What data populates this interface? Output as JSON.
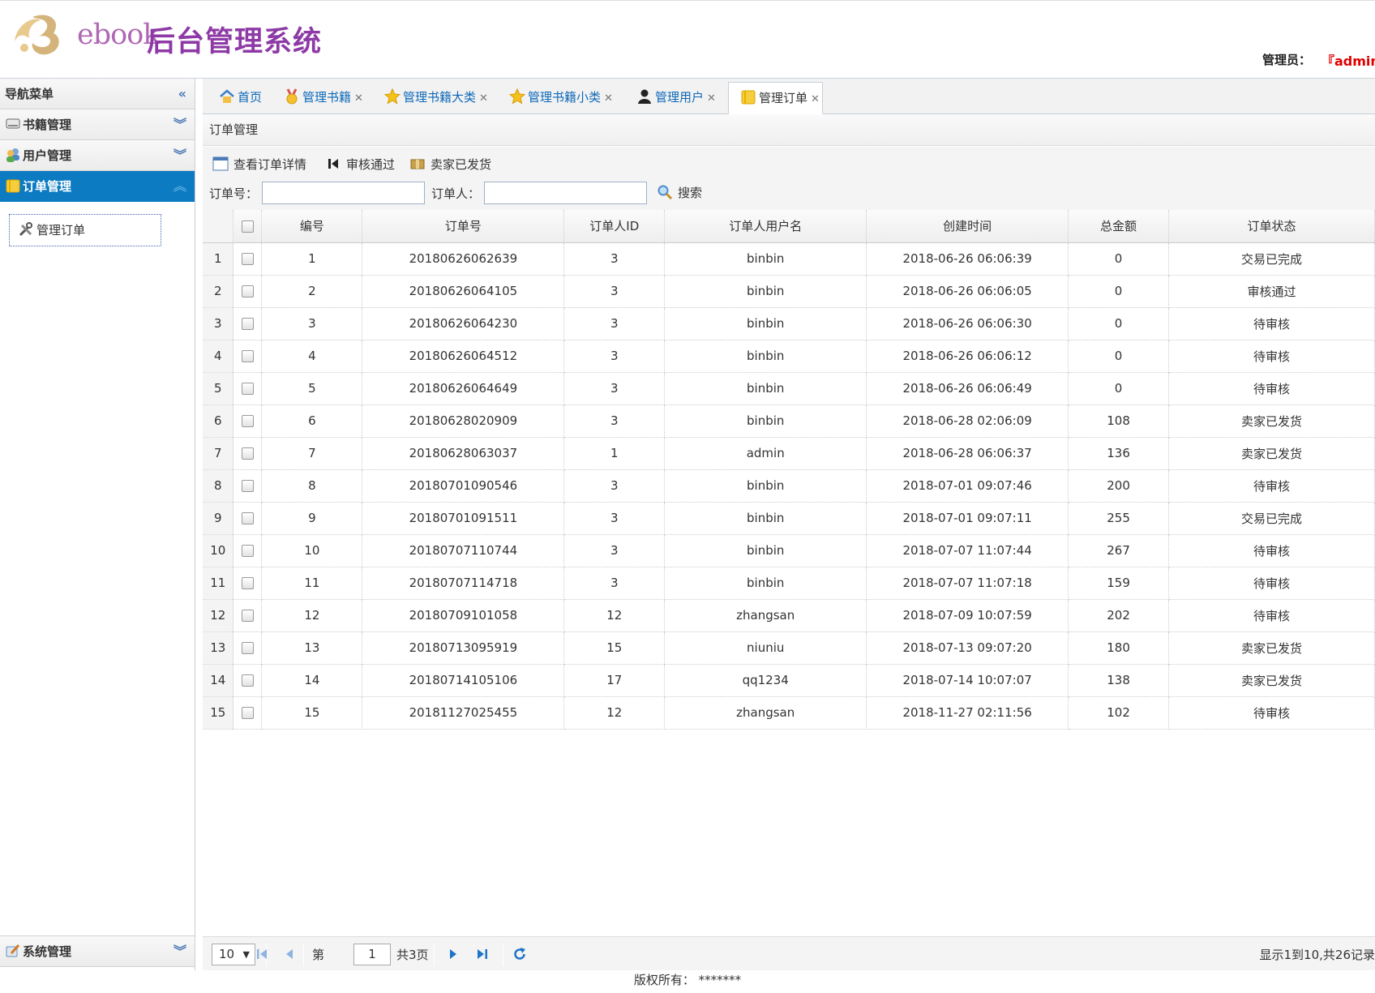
{
  "header": {
    "logo_text": "ebook",
    "title": "后台管理系统",
    "admin_label": "管理员：",
    "admin_name": "『admin』"
  },
  "sidebar": {
    "title": "导航菜单",
    "sections": [
      {
        "label": "书籍管理"
      },
      {
        "label": "用户管理"
      },
      {
        "label": "订单管理"
      }
    ],
    "active_item": "管理订单",
    "bottom_section": "系统管理"
  },
  "tabs": [
    {
      "label": "首页"
    },
    {
      "label": "管理书籍"
    },
    {
      "label": "管理书籍大类"
    },
    {
      "label": "管理书籍小类"
    },
    {
      "label": "管理用户"
    },
    {
      "label": "管理订单"
    }
  ],
  "panel": {
    "title": "订单管理"
  },
  "toolbar": {
    "view_detail": "查看订单详情",
    "approve": "审核通过",
    "shipped": "卖家已发货",
    "order_no_label": "订单号：",
    "orderer_label": "订单人：",
    "order_no_value": "",
    "orderer_value": "",
    "search": "搜索"
  },
  "grid": {
    "columns": [
      "编号",
      "订单号",
      "订单人ID",
      "订单人用户名",
      "创建时间",
      "总金额",
      "订单状态"
    ],
    "rows": [
      {
        "rn": "1",
        "id": "1",
        "order_no": "20180626062639",
        "user_id": "3",
        "user_name": "binbin",
        "created": "2018-06-26 06:06:39",
        "amount": "0",
        "status": "交易已完成"
      },
      {
        "rn": "2",
        "id": "2",
        "order_no": "20180626064105",
        "user_id": "3",
        "user_name": "binbin",
        "created": "2018-06-26 06:06:05",
        "amount": "0",
        "status": "审核通过"
      },
      {
        "rn": "3",
        "id": "3",
        "order_no": "20180626064230",
        "user_id": "3",
        "user_name": "binbin",
        "created": "2018-06-26 06:06:30",
        "amount": "0",
        "status": "待审核"
      },
      {
        "rn": "4",
        "id": "4",
        "order_no": "20180626064512",
        "user_id": "3",
        "user_name": "binbin",
        "created": "2018-06-26 06:06:12",
        "amount": "0",
        "status": "待审核"
      },
      {
        "rn": "5",
        "id": "5",
        "order_no": "20180626064649",
        "user_id": "3",
        "user_name": "binbin",
        "created": "2018-06-26 06:06:49",
        "amount": "0",
        "status": "待审核"
      },
      {
        "rn": "6",
        "id": "6",
        "order_no": "20180628020909",
        "user_id": "3",
        "user_name": "binbin",
        "created": "2018-06-28 02:06:09",
        "amount": "108",
        "status": "卖家已发货"
      },
      {
        "rn": "7",
        "id": "7",
        "order_no": "20180628063037",
        "user_id": "1",
        "user_name": "admin",
        "created": "2018-06-28 06:06:37",
        "amount": "136",
        "status": "卖家已发货"
      },
      {
        "rn": "8",
        "id": "8",
        "order_no": "20180701090546",
        "user_id": "3",
        "user_name": "binbin",
        "created": "2018-07-01 09:07:46",
        "amount": "200",
        "status": "待审核"
      },
      {
        "rn": "9",
        "id": "9",
        "order_no": "20180701091511",
        "user_id": "3",
        "user_name": "binbin",
        "created": "2018-07-01 09:07:11",
        "amount": "255",
        "status": "交易已完成"
      },
      {
        "rn": "10",
        "id": "10",
        "order_no": "20180707110744",
        "user_id": "3",
        "user_name": "binbin",
        "created": "2018-07-07 11:07:44",
        "amount": "267",
        "status": "待审核"
      },
      {
        "rn": "11",
        "id": "11",
        "order_no": "20180707114718",
        "user_id": "3",
        "user_name": "binbin",
        "created": "2018-07-07 11:07:18",
        "amount": "159",
        "status": "待审核"
      },
      {
        "rn": "12",
        "id": "12",
        "order_no": "20180709101058",
        "user_id": "12",
        "user_name": "zhangsan",
        "created": "2018-07-09 10:07:59",
        "amount": "202",
        "status": "待审核"
      },
      {
        "rn": "13",
        "id": "13",
        "order_no": "20180713095919",
        "user_id": "15",
        "user_name": "niuniu",
        "created": "2018-07-13 09:07:20",
        "amount": "180",
        "status": "卖家已发货"
      },
      {
        "rn": "14",
        "id": "14",
        "order_no": "20180714105106",
        "user_id": "17",
        "user_name": "qq1234",
        "created": "2018-07-14 10:07:07",
        "amount": "138",
        "status": "卖家已发货"
      },
      {
        "rn": "15",
        "id": "15",
        "order_no": "20181127025455",
        "user_id": "12",
        "user_name": "zhangsan",
        "created": "2018-11-27 02:11:56",
        "amount": "102",
        "status": "待审核"
      }
    ]
  },
  "pager": {
    "page_size": "10",
    "page_prefix": "第",
    "page_value": "1",
    "page_total": "共3页",
    "info": "显示1到10,共26记录"
  },
  "footer": {
    "copyright": "版权所有：  *******"
  },
  "colors": {
    "accent": "#0c7bc2",
    "brand": "#8e3aa6",
    "admin": "#e00000"
  }
}
